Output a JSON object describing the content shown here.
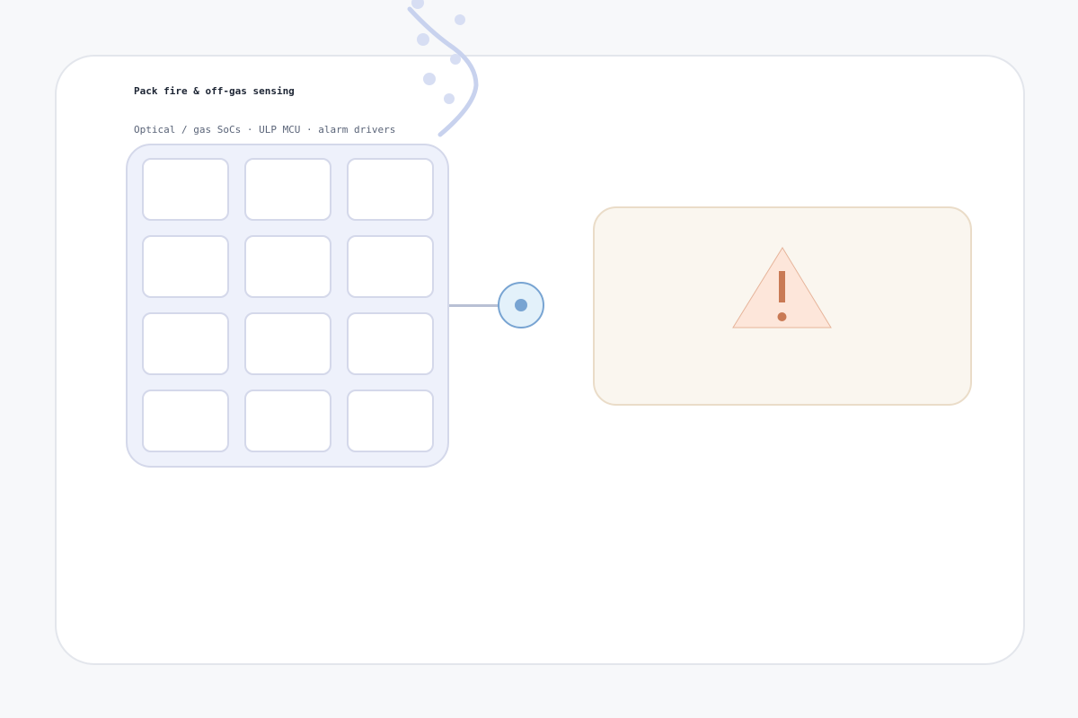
{
  "header": {
    "title": "Pack fire & off-gas sensing",
    "subtitle": "Optical / gas SoCs · ULP MCU · alarm drivers"
  },
  "battery_pack": {
    "rows": 4,
    "cols": 3
  },
  "colors": {
    "background": "#f7f8fa",
    "card": "#ffffff",
    "pack_fill": "#eef1fb",
    "cell_border": "#d4d8ea",
    "smoke": "#c8d2ee",
    "sensor": "#78a4d2",
    "alarm_fill": "#fde6da",
    "alarm_accent": "#c97a55"
  },
  "icons": {
    "smoke": "smoke-plume-icon",
    "sensor": "sensor-node-icon",
    "alarm": "warning-triangle-icon"
  }
}
